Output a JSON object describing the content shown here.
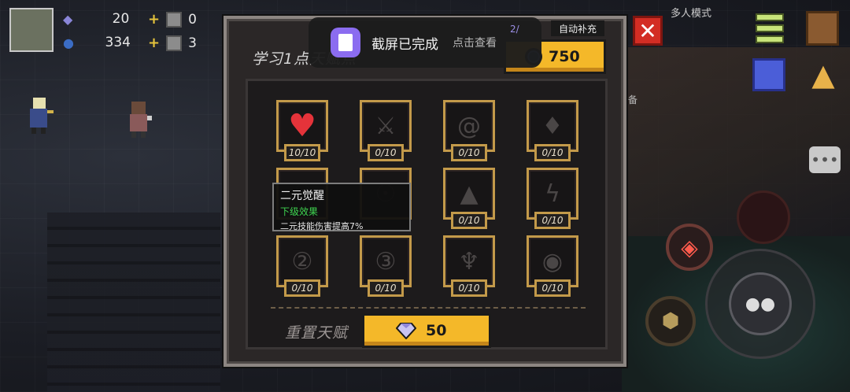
{
  "hud": {
    "gems": "20",
    "coins": "334",
    "material_1": "0",
    "material_2": "3"
  },
  "right_hud": {
    "multiplayer_label": "多人模式",
    "equip_label": "备",
    "auto_supply": "自动补充",
    "gem_mini": "2/"
  },
  "toast": {
    "title": "截屏已完成",
    "action": "点击查看"
  },
  "panel": {
    "title": "学习1点天赋点",
    "learn_cost": "750",
    "reset_label": "重置天赋",
    "reset_cost": "50",
    "talents": [
      {
        "count": "10/10",
        "icon": "heart-icon"
      },
      {
        "count": "0/10",
        "icon": "sword-icon"
      },
      {
        "count": "0/10",
        "icon": "swirl-icon"
      },
      {
        "count": "0/10",
        "icon": "drop-icon"
      },
      {
        "count": "",
        "icon": "skull-icon"
      },
      {
        "count": "",
        "icon": "mask-icon"
      },
      {
        "count": "0/10",
        "icon": "hood-icon"
      },
      {
        "count": "0/10",
        "icon": "lightning-icon"
      },
      {
        "count": "0/10",
        "icon": "number-two-icon"
      },
      {
        "count": "0/10",
        "icon": "number-three-icon"
      },
      {
        "count": "0/10",
        "icon": "demon-icon"
      },
      {
        "count": "0/10",
        "icon": "eye-icon"
      }
    ]
  },
  "tooltip": {
    "title": "二元觉醒",
    "subtitle": "下级效果",
    "description": "二元技能伤害提高7%"
  },
  "colors": {
    "gold": "#f4b829",
    "frame": "#c39a4a",
    "heart": "#e5333a",
    "tooltip_green": "#3fd44f"
  }
}
